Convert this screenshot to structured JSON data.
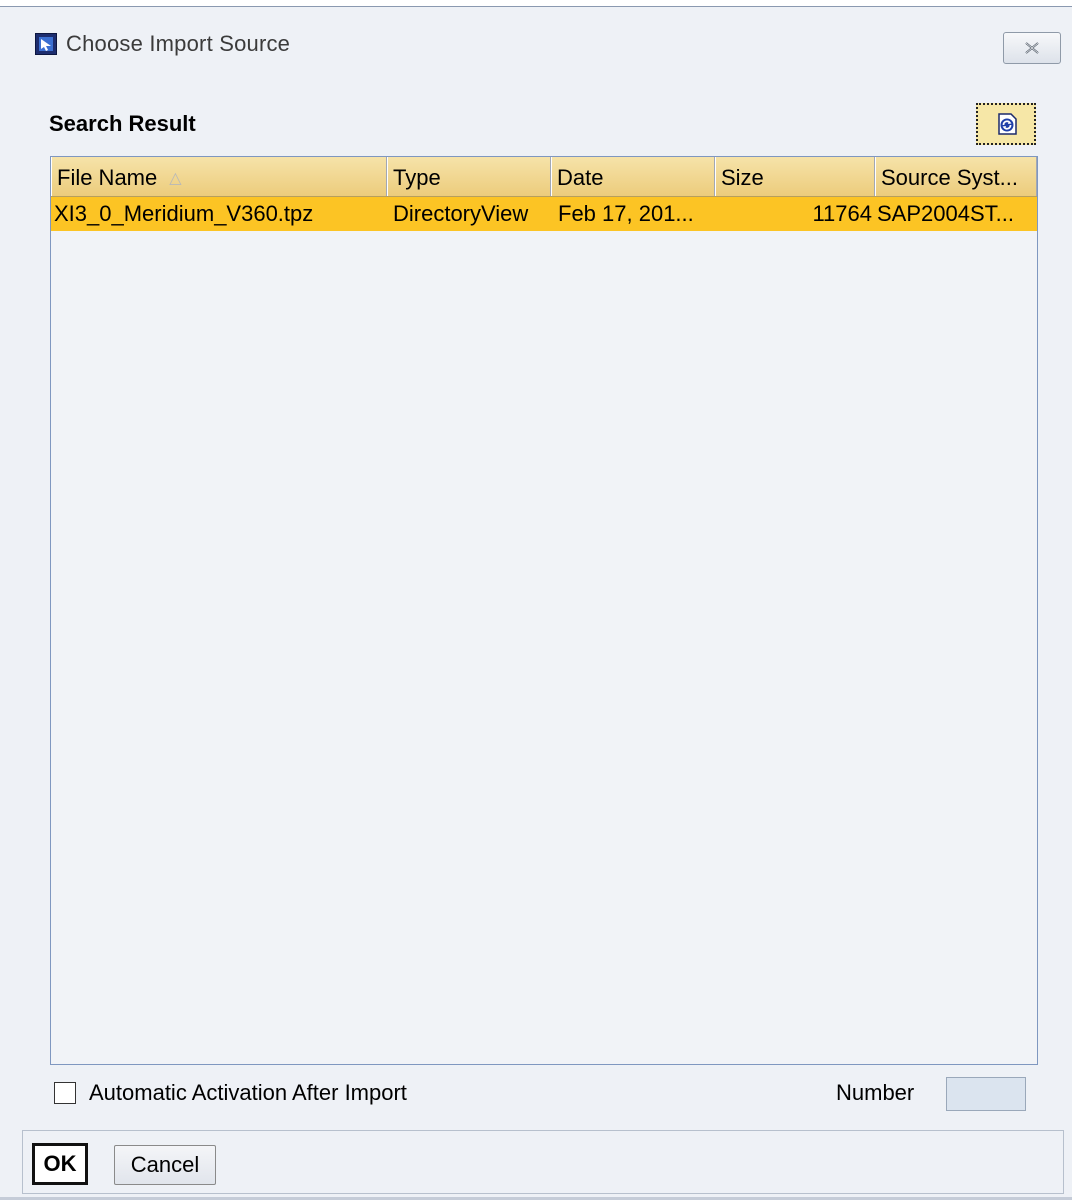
{
  "window": {
    "title": "Choose Import Source",
    "icon": "app-window-icon",
    "close_icon": "close-icon"
  },
  "search_result": {
    "title": "Search Result",
    "refresh_icon": "refresh-icon"
  },
  "table": {
    "columns": [
      {
        "label": "File Name",
        "sorted": "ascending"
      },
      {
        "label": "Type"
      },
      {
        "label": "Date"
      },
      {
        "label": "Size"
      },
      {
        "label": "Source Syst..."
      }
    ],
    "rows": [
      {
        "file_name": "XI3_0_Meridium_V360.tpz",
        "type": "DirectoryView",
        "date": "Feb 17, 201...",
        "size": "11764",
        "source_system": "SAP2004ST...",
        "selected": true
      }
    ],
    "selection_color": "#fcc424",
    "header_color": "#f1d894"
  },
  "options": {
    "auto_activation_label": "Automatic Activation After Import",
    "auto_activation_checked": false,
    "number_label": "Number",
    "number_value": ""
  },
  "buttons": {
    "ok": "OK",
    "cancel": "Cancel"
  }
}
